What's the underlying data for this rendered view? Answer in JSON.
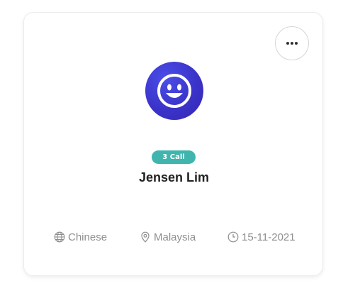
{
  "card": {
    "more_icon": "ellipsis-icon",
    "avatar_icon": "smiley-face-icon",
    "badge": "3 Call",
    "name": "Jensen Lim",
    "meta": {
      "language": "Chinese",
      "location": "Malaysia",
      "date": "15-11-2021"
    }
  },
  "colors": {
    "badge": "#3fb5ad",
    "avatar": "#3b33c9",
    "meta_text": "#8e8e8e"
  }
}
